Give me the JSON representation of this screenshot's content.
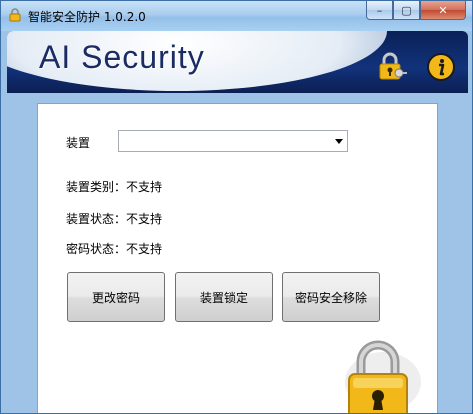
{
  "window": {
    "title": "智能安全防护 1.0.2.0",
    "minimize_label": "–",
    "maximize_label": "▢",
    "close_label": "✕"
  },
  "banner": {
    "title": "AI Security",
    "icons": [
      "lock-key-icon",
      "info-icon"
    ]
  },
  "form": {
    "device_label": "装置",
    "device_value": "",
    "device_type": "装置类别：不支持",
    "device_status": "装置状态：不支持",
    "password_status": "密码状态：不支持"
  },
  "buttons": {
    "change_password": "更改密码",
    "lock_device": "装置锁定",
    "remove_password": "密码安全移除"
  },
  "colors": {
    "banner_dark": "#0a2157",
    "accent_gold": "#f2b81a",
    "window_frame": "#9ec3e6"
  }
}
